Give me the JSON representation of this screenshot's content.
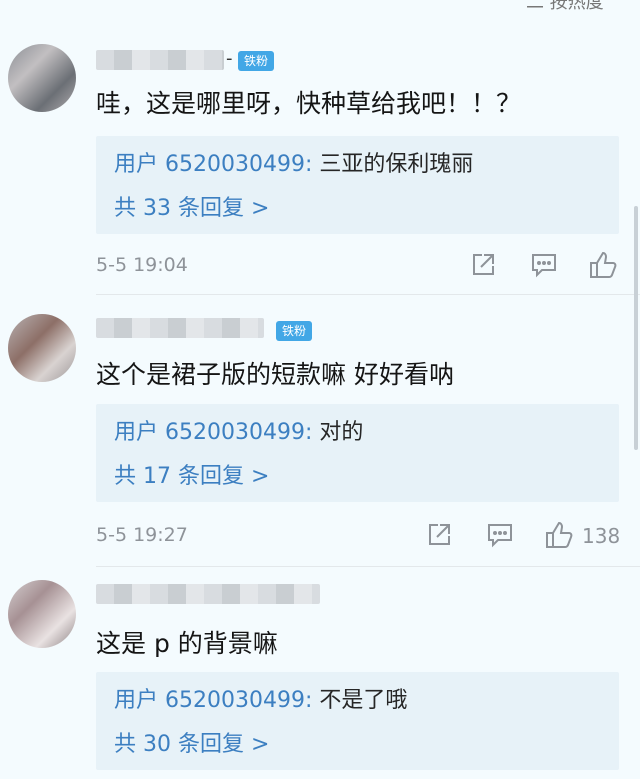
{
  "header": {
    "sort_label": "二 按热度"
  },
  "comments": [
    {
      "badge": "铁粉",
      "text": "哇，这是哪里呀，快种草给我吧！！？",
      "reply_user": "用户 6520030499:",
      "reply_text": "三亚的保利瑰丽",
      "reply_count": "共 33 条回复 >",
      "time": "5-5 19:04",
      "likes": ""
    },
    {
      "badge": "铁粉",
      "text": "这个是裙子版的短款嘛 好好看呐",
      "reply_user": "用户 6520030499:",
      "reply_text": "对的",
      "reply_count": "共 17 条回复 >",
      "time": "5-5 19:27",
      "likes": "138"
    },
    {
      "badge": "",
      "text": "这是 p 的背景嘛",
      "reply_user": "用户 6520030499:",
      "reply_text": "不是了哦",
      "reply_count": "共 30 条回复 >",
      "time": "",
      "likes": ""
    }
  ]
}
